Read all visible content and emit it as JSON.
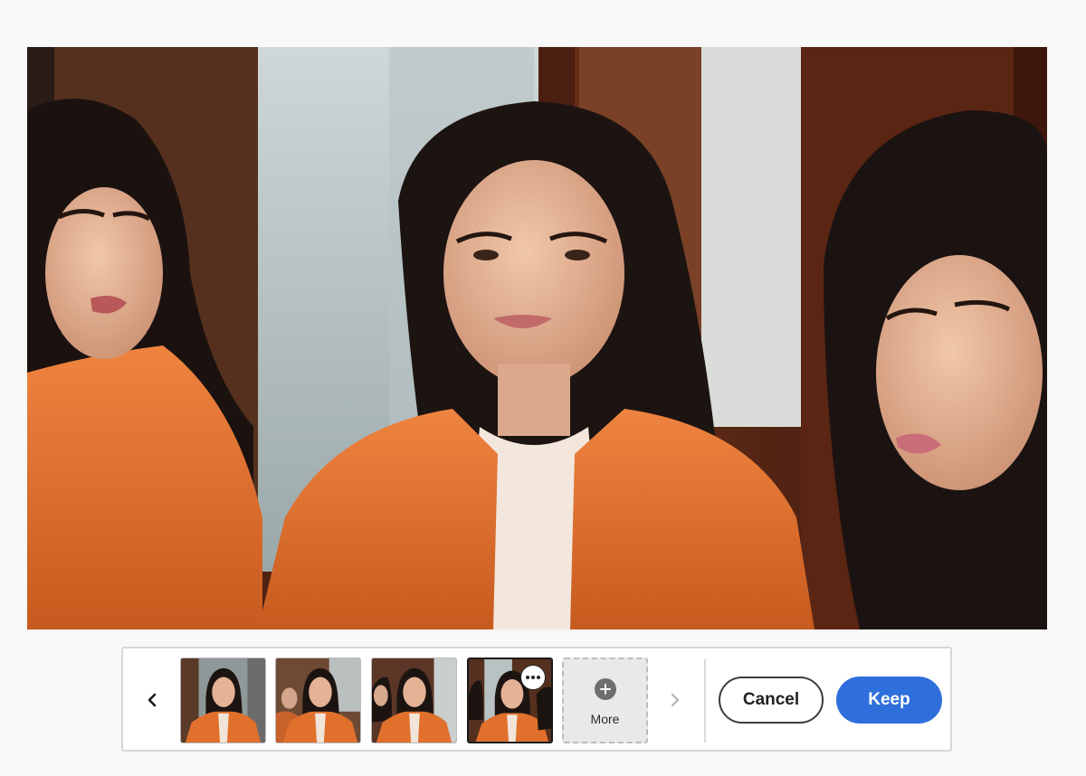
{
  "canvas": {
    "image": "generated-portrait-variation-4"
  },
  "variations": {
    "prev_icon": "chevron-left-icon",
    "next_icon": "chevron-right-icon",
    "items": [
      {
        "name": "variation-1",
        "selected": false
      },
      {
        "name": "variation-2",
        "selected": false
      },
      {
        "name": "variation-3",
        "selected": false
      },
      {
        "name": "variation-4",
        "selected": true
      }
    ],
    "more_options_icon": "ellipsis-icon",
    "more_tile": {
      "icon": "plus-circle-icon",
      "label": "More"
    }
  },
  "actions": {
    "cancel_label": "Cancel",
    "keep_label": "Keep"
  },
  "colors": {
    "accent": "#2f6fdc",
    "jacket": "#e0702c",
    "hair": "#1c1411",
    "skin": "#e6b597",
    "wood": "#5a2a18"
  }
}
